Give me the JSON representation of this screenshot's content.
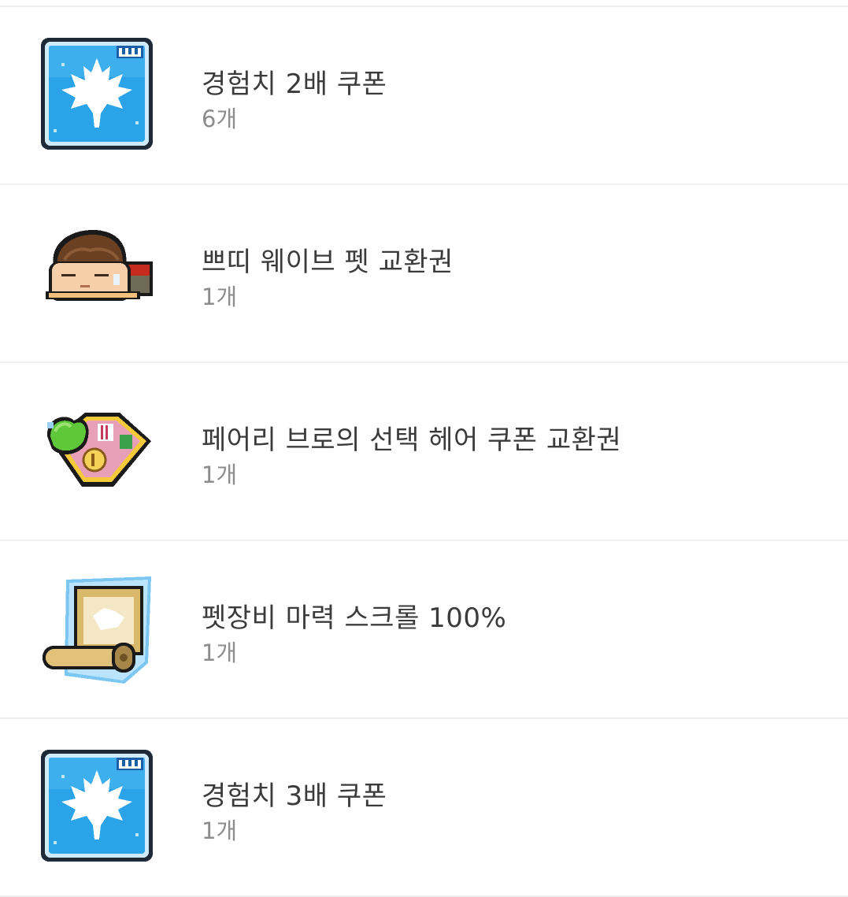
{
  "items": [
    {
      "name": "경험치 2배 쿠폰",
      "count": "6개",
      "icon": "maple-leaf-exp-coupon-icon"
    },
    {
      "name": "쁘띠 웨이브 펫 교환권",
      "count": "1개",
      "icon": "pet-character-icon"
    },
    {
      "name": "페어리 브로의 선택 헤어 쿠폰 교환권",
      "count": "1개",
      "icon": "hair-coupon-icon"
    },
    {
      "name": "펫장비 마력 스크롤 100%",
      "count": "1개",
      "icon": "scroll-icon"
    },
    {
      "name": "경험치 3배 쿠폰",
      "count": "1개",
      "icon": "maple-leaf-exp-coupon-icon"
    }
  ],
  "colors": {
    "divider": "#efefef",
    "name_text": "#3b3b3b",
    "count_text": "#8c8c8c",
    "coupon_blue": "#2aa3e8"
  }
}
